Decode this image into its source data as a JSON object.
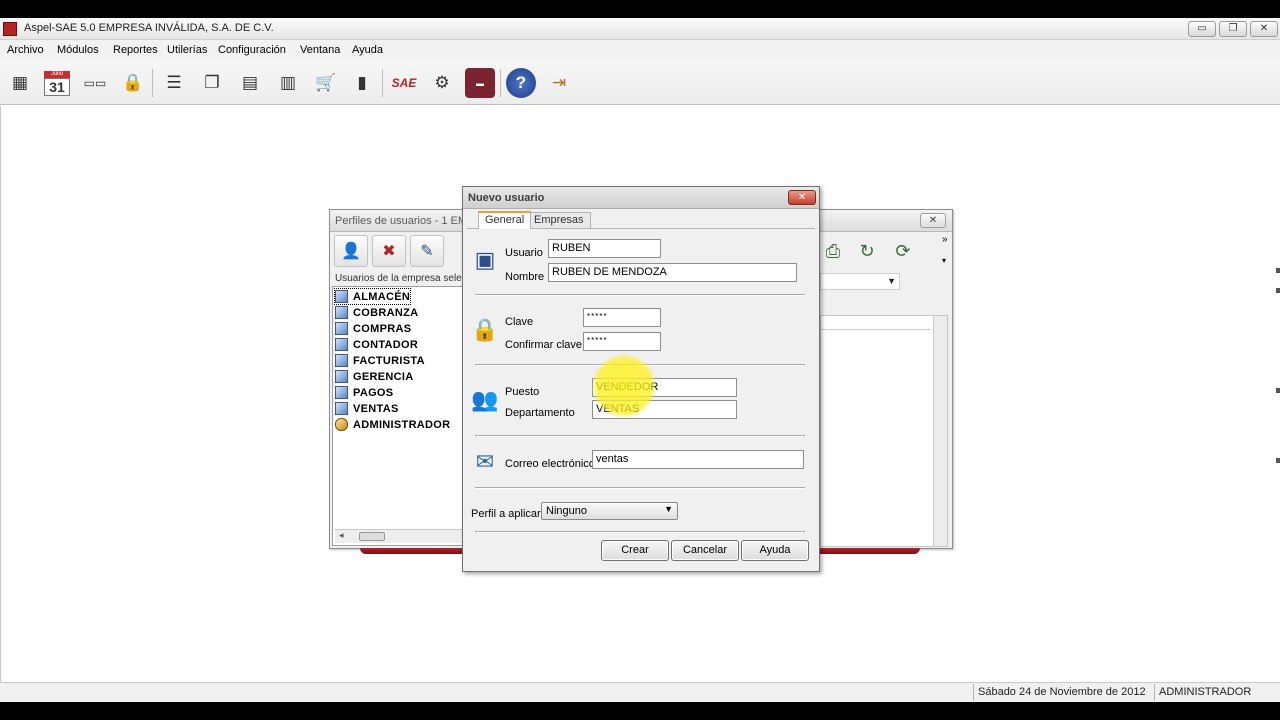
{
  "app": {
    "title": "Aspel-SAE 5.0  EMPRESA INVÁLIDA, S.A. DE C.V.",
    "window_buttons": {
      "minimize": "▭",
      "restore": "❐",
      "close": "✕"
    }
  },
  "menu": [
    "Archivo",
    "Módulos",
    "Reportes",
    "Utilerías",
    "Configuración",
    "Ventana",
    "Ayuda"
  ],
  "toolbar": {
    "calendar_month": "Julio",
    "calendar_day": "31",
    "icons": [
      "catalog-icon",
      "calendar-icon",
      "fonts-icon",
      "lock-building-icon",
      "clients-icon",
      "windows-icon",
      "documents-icon",
      "invoices-icon",
      "cart-icon",
      "chart-icon",
      "sae-logo-icon",
      "network-icon",
      "notebook-icon",
      "help-icon",
      "exit-icon"
    ]
  },
  "status": {
    "date": "Sábado 24 de Noviembre de 2012",
    "user": "ADMINISTRADOR"
  },
  "perfiles": {
    "title": "Perfiles de usuarios - 1 EM",
    "close": "✕",
    "list_caption": "Usuarios de la empresa selec",
    "profiles": [
      "ALMACÉN",
      "COBRANZA",
      "COMPRAS",
      "CONTADOR",
      "FACTURISTA",
      "GERENCIA",
      "PAGOS",
      "VENTAS",
      "ADMINISTRADOR"
    ]
  },
  "dialog": {
    "title": "Nuevo usuario",
    "close": "✕",
    "tabs": [
      "General",
      "Empresas"
    ],
    "fields": {
      "usuario_label": "Usuario",
      "usuario_value": "RUBEN",
      "nombre_label": "Nombre",
      "nombre_value": "RUBEN DE MENDOZA",
      "clave_label": "Clave",
      "clave_value": "*****",
      "confirmar_label": "Confirmar clave",
      "confirmar_value": "*****",
      "puesto_label": "Puesto",
      "puesto_value": "VENDEDOR",
      "departamento_label": "Departamento",
      "departamento_value": "VENTAS",
      "correo_label": "Correo electrónico",
      "correo_value": "ventas",
      "perfil_label": "Perfil a aplicar",
      "perfil_value": "Ninguno"
    },
    "buttons": {
      "crear": "Crear",
      "cancelar": "Cancelar",
      "ayuda": "Ayuda"
    }
  },
  "colors": {
    "accent_tab": "#e6a23c",
    "close_red": "#c3402b",
    "cursor_highlight": "#fff01e"
  }
}
